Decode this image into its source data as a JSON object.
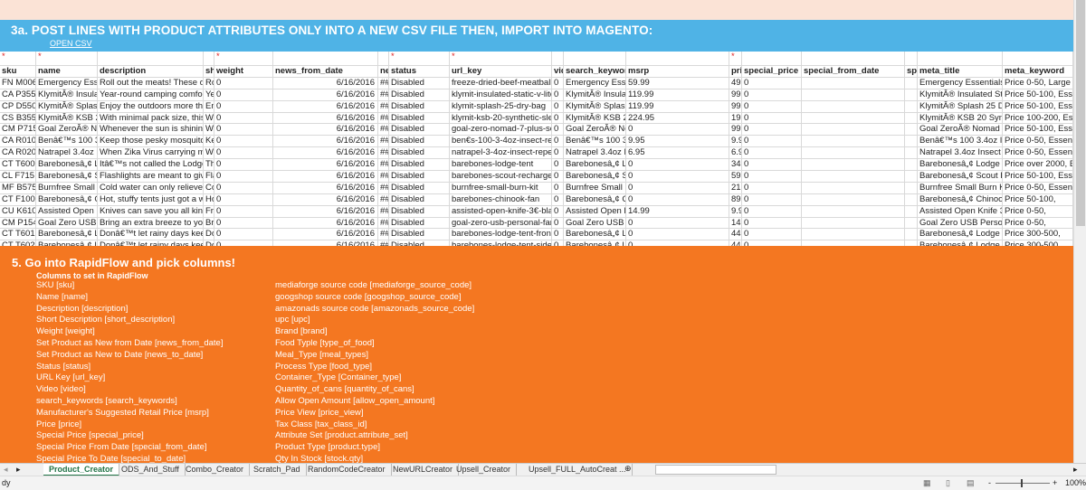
{
  "banner": {
    "title": "3a. POST LINES WITH PRODUCT ATTRIBUTES ONLY INTO A NEW CSV FILE THEN, IMPORT INTO MAGENTO:",
    "link": "OPEN CSV"
  },
  "table": {
    "required_marker": "*",
    "required_columns": [
      0,
      1,
      4,
      7,
      8,
      12
    ],
    "headers": [
      "sku",
      "name",
      "description",
      "sh",
      "weight",
      "news_from_date",
      "ne",
      "status",
      "url_key",
      "vid",
      "search_keyword",
      "msrp",
      "pri",
      "special_price",
      "special_from_date",
      "sp",
      "meta_title",
      "meta_keyword"
    ],
    "rows": [
      [
        "FN M006",
        "Emergency Essen",
        "Roll out the meats! These de",
        "Ro",
        "0",
        "6/16/2016",
        "##",
        "Disabled",
        "freeze-dried-beef-meatballs",
        "0",
        "Emergency Esser",
        "59.99",
        "49.",
        "0",
        "",
        "",
        "Emergency EssentialsÂ®",
        "Price 0-50, Large Car"
      ],
      [
        "CA P355",
        "KlymitÂ® Insulate",
        "Year-round camping comfort",
        "Ye",
        "0",
        "6/16/2016",
        "##",
        "Disabled",
        "klymit-insulated-static-v-lite",
        "0",
        "KlymitÂ® Insulat",
        "119.99",
        "99.",
        "0",
        "",
        "",
        "KlymitÂ® Insulated Stat",
        "Price 50-100, Essent"
      ],
      [
        "CP D550",
        "KlymitÂ® Splash 2",
        "Enjoy the outdoors more tho",
        "En",
        "0",
        "6/16/2016",
        "##",
        "Disabled",
        "klymit-splash-25-dry-bag",
        "0",
        "KlymitÂ® Splash",
        "119.99",
        "99.",
        "0",
        "",
        "",
        "KlymitÂ® Splash 25 Dry",
        "Price 50-100, Essent"
      ],
      [
        "CS B355",
        "KlymitÂ® KSB 20 S",
        "With minimal pack size, this",
        "Wi",
        "0",
        "6/16/2016",
        "##",
        "Disabled",
        "klymit-ksb-20-synthetic-slee",
        "0",
        "KlymitÂ® KSB 20",
        "224.95",
        "19!",
        "0",
        "",
        "",
        "KlymitÂ® KSB 20 Synthe",
        "Price 100-200, Essen"
      ],
      [
        "CM P715",
        "Goal ZeroÂ® Nom",
        "Whenever the sun is shining,",
        "Wl",
        "0",
        "6/16/2016",
        "##",
        "Disabled",
        "goal-zero-nomad-7-plus-sola",
        "0",
        "Goal ZeroÂ® Non",
        "0",
        "99.",
        "0",
        "",
        "",
        "Goal ZeroÂ® Nomad 7 P",
        "Price 50-100, Essent"
      ],
      [
        "CA R010",
        "Benâ€™s 100 3.4o",
        "Keep those pesky mosquitoe",
        "Ke",
        "0",
        "6/16/2016",
        "##",
        "Disabled",
        "ben€s-100-3-4oz-insect-repe",
        "0",
        "Benâ€™s 100 3.4",
        "9.95",
        "9.9",
        "0",
        "",
        "",
        "Benâ€™s 100 3.4oz Inse",
        "Price 0-50, Essential"
      ],
      [
        "CA R020",
        "Natrapel 3.4oz In",
        "When Zika Virus carrying mo:",
        "Wl",
        "0",
        "6/16/2016",
        "##",
        "Disabled",
        "natrapel-3-4oz-insect-repell",
        "0",
        "Natrapel 3.4oz In",
        "6.95",
        "6.9",
        "0",
        "",
        "",
        "Natrapel 3.4oz Insect Re",
        "Price 0-50, Essential"
      ],
      [
        "CT T600",
        "Barebonesâ„¢ Lo",
        "Itâ€™s not called the Lodge T",
        "Th",
        "0",
        "6/16/2016",
        "##",
        "Disabled",
        "barebones-lodge-tent",
        "0",
        "Barebonesâ„¢ Lo",
        "0",
        "34!",
        "0",
        "",
        "",
        "Barebonesâ„¢ Lodge Te",
        "Price over 2000, Esse"
      ],
      [
        "CL F715",
        "Barebonesâ„¢ Sco",
        "Flashlights are meant to give",
        "Fla",
        "0",
        "6/16/2016",
        "##",
        "Disabled",
        "barebones-scout-rechargeab",
        "0",
        "Barebonesâ„¢ Sc",
        "0",
        "59.",
        "0",
        "",
        "",
        "Barebonesâ„¢ Scout Re",
        "Price 50-100, Essent"
      ],
      [
        "MF B575",
        "Burnfree Small Bu",
        "Cold water can only relieve b",
        "Co",
        "0",
        "6/16/2016",
        "##",
        "Disabled",
        "burnfree-small-burn-kit",
        "0",
        "Burnfree Small B",
        "0",
        "21",
        "0",
        "",
        "",
        "Burnfree Small Burn Kit",
        "Price 0-50, Essential"
      ],
      [
        "CT F100",
        "Barebonesâ„¢ Chi",
        "Hot, stuffy tents just got a wl",
        "Ho",
        "0",
        "6/16/2016",
        "##",
        "Disabled",
        "barebones-chinook-fan",
        "0",
        "Barebonesâ„¢ Ch",
        "0",
        "89.",
        "0",
        "",
        "",
        "Barebonesâ„¢ Chinook",
        "Price 50-100,"
      ],
      [
        "CU K610",
        "Assisted Open Kn",
        "Knives can save you all kinds",
        "Frc",
        "0",
        "6/16/2016",
        "##",
        "Disabled",
        "assisted-open-knife-3€-blad",
        "0",
        "Assisted Open Kı",
        "14.99",
        "9.9",
        "0",
        "",
        "",
        "Assisted Open Knife 3â€",
        "Price 0-50,"
      ],
      [
        "CM P154",
        "Goal Zero USB Pe",
        "Bring an extra breeze to your",
        "Bri",
        "0",
        "6/16/2016",
        "##",
        "Disabled",
        "goal-zero-usb-personal-fan",
        "0",
        "Goal Zero USB Pe",
        "0",
        "14.",
        "0",
        "",
        "",
        "Goal Zero USB Personal",
        "Price 0-50,"
      ],
      [
        "CT T601",
        "Barebonesâ„¢ Loc",
        "Donâ€™t let rainy days keep",
        "Do",
        "0",
        "6/16/2016",
        "##",
        "Disabled",
        "barebones-lodge-tent-front-",
        "0",
        "Barebonesâ„¢ Lo",
        "0",
        "44!",
        "0",
        "",
        "",
        "Barebonesâ„¢ Lodge Te",
        "Price 300-500,"
      ],
      [
        "CT T602",
        "Barebonesâ„¢ Loc",
        "Donâ€™t let rainy days keep",
        "Do",
        "0",
        "6/16/2016",
        "##",
        "Disabled",
        "barebones-lodge-tent-side-a",
        "0",
        "Barebonesâ„¢ Lo",
        "0",
        "44!",
        "0",
        "",
        "",
        "Barebonesâ„¢ Lodge Te",
        "Price 300-500,"
      ]
    ]
  },
  "rapidflow": {
    "title": "5. Go into RapidFlow and pick columns!",
    "subtitle": "Columns to set in RapidFlow",
    "left": [
      "SKU [sku]",
      "Name [name]",
      "Description [description]",
      "Short Description [short_description]",
      "Weight [weight]",
      "Set Product as New from Date [news_from_date]",
      "Set Product as New to Date [news_to_date]",
      "Status [status]",
      "URL Key [url_key]",
      "Video [video]",
      "search_keywords [search_keywords]",
      "Manufacturer's Suggested Retail Price [msrp]",
      "Price [price]",
      "Special Price [special_price]",
      "Special Price From Date [special_from_date]",
      "Special Price To Date [special_to_date]"
    ],
    "right": [
      "mediaforge source code [mediaforge_source_code]",
      "googshop source code [googshop_source_code]",
      "amazonads source code [amazonads_source_code]",
      "upc [upc]",
      "Brand [brand]",
      "Food Typle [type_of_food]",
      "Meal_Type [meal_types]",
      "Process Type [food_type]",
      "Container_Type [Container_type]",
      "Quantity_of_cans [quantity_of_cans]",
      "Allow Open Amount [allow_open_amount]",
      "Price View [price_view]",
      "Tax Class [tax_class_id]",
      "Attribute Set [product.attribute_set]",
      "Product Type [product.type]",
      "Qty In Stock [stock.qty]"
    ]
  },
  "sheet_tabs": {
    "items": [
      "Product_Creator",
      "ODS_And_Stuff",
      "Combo_Creator",
      "Scratch_Pad",
      "RandomCodeCreator",
      "NewURLCreator",
      "Upsell_Creator",
      "Upsell_FULL_AutoCreat ..."
    ],
    "active": 0,
    "add": "⊕"
  },
  "status_bar": {
    "mode": "dy",
    "zoom": "100%"
  },
  "colors": {
    "banner": "#4fb3e6",
    "section": "#f47721",
    "accent": "#217346"
  }
}
